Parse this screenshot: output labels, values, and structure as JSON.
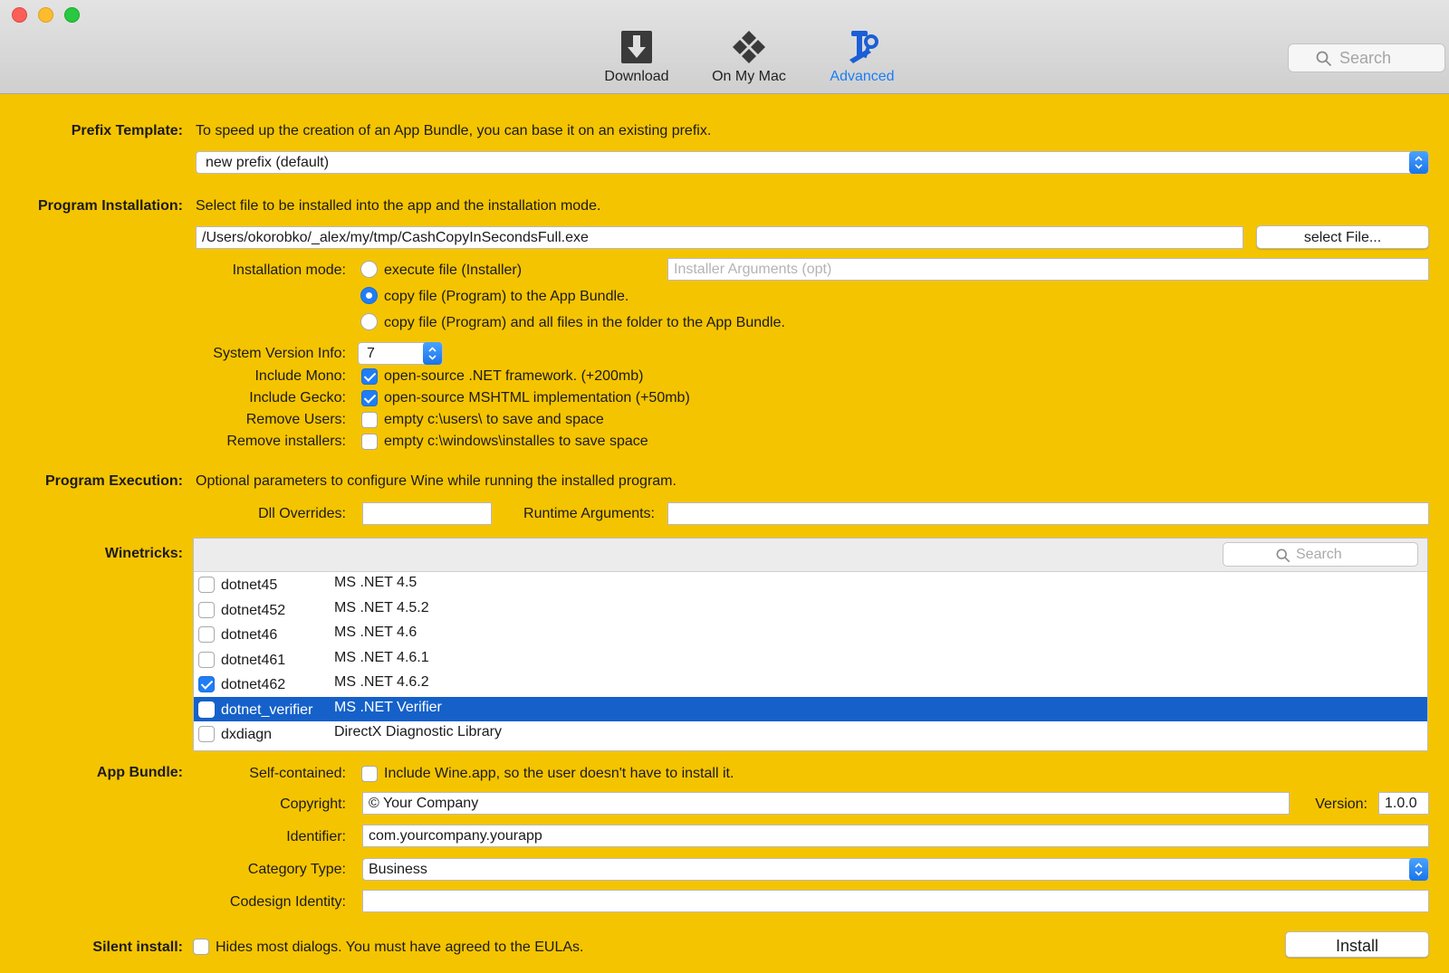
{
  "toolbar": {
    "download_label": "Download",
    "onmymac_label": "On My Mac",
    "advanced_label": "Advanced",
    "search_placeholder": "Search",
    "active_color": "#1b7ef5"
  },
  "prefix": {
    "label": "Prefix Template:",
    "description": "To speed up the creation of an App Bundle, you can base it on an existing prefix.",
    "selected": "new prefix (default)"
  },
  "install": {
    "label": "Program Installation:",
    "description": "Select file to be installed into the app and the installation mode.",
    "file_path": "/Users/okorobko/_alex/my/tmp/CashCopyInSecondsFull.exe",
    "select_button": "select File...",
    "mode_label": "Installation mode:",
    "modes": [
      {
        "label": "execute file (Installer)",
        "selected": false
      },
      {
        "label": "copy file (Program)  to the App Bundle.",
        "selected": true
      },
      {
        "label": "copy file (Program)  and all files in the folder to the App Bundle.",
        "selected": false
      }
    ],
    "installer_args_placeholder": "Installer Arguments (opt)",
    "sysver_label": "System Version Info:",
    "sysver_value": "7",
    "options": [
      {
        "label": "Include Mono:",
        "text": "open-source .NET framework. (+200mb)",
        "checked": true
      },
      {
        "label": "Include Gecko:",
        "text": "open-source MSHTML implementation (+50mb)",
        "checked": true
      },
      {
        "label": "Remove Users:",
        "text": "empty c:\\users\\ to save and space",
        "checked": false
      },
      {
        "label": "Remove installers:",
        "text": "empty c:\\windows\\installes to save space",
        "checked": false
      }
    ]
  },
  "execution": {
    "label": "Program Execution:",
    "description": "Optional parameters to configure Wine while running the installed program.",
    "dll_label": "Dll Overrides:",
    "dll_value": "",
    "runtime_label": "Runtime Arguments:",
    "runtime_value": ""
  },
  "winetricks": {
    "label": "Winetricks:",
    "search_placeholder": "Search",
    "items": [
      {
        "name": "dotnet45",
        "desc": "MS .NET 4.5",
        "checked": false,
        "selected": false
      },
      {
        "name": "dotnet452",
        "desc": "MS .NET 4.5.2",
        "checked": false,
        "selected": false
      },
      {
        "name": "dotnet46",
        "desc": "MS .NET 4.6",
        "checked": false,
        "selected": false
      },
      {
        "name": "dotnet461",
        "desc": "MS .NET 4.6.1",
        "checked": false,
        "selected": false
      },
      {
        "name": "dotnet462",
        "desc": "MS .NET 4.6.2",
        "checked": true,
        "selected": false
      },
      {
        "name": "dotnet_verifier",
        "desc": "MS .NET Verifier",
        "checked": false,
        "selected": true
      },
      {
        "name": "dxdiagn",
        "desc": "DirectX Diagnostic Library",
        "checked": false,
        "selected": false
      }
    ]
  },
  "bundle": {
    "label": "App Bundle:",
    "selfcontained_label": "Self-contained:",
    "selfcontained_text": "Include Wine.app, so the user doesn't have to install it.",
    "selfcontained_checked": false,
    "copyright_label": "Copyright:",
    "copyright_value": "© Your Company",
    "version_label": "Version:",
    "version_value": "1.0.0",
    "identifier_label": "Identifier:",
    "identifier_value": "com.yourcompany.yourapp",
    "category_label": "Category Type:",
    "category_value": "Business",
    "codesign_label": "Codesign Identity:",
    "codesign_value": ""
  },
  "silent": {
    "label": "Silent install:",
    "text": "Hides most dialogs. You must have agreed to the EULAs.",
    "checked": false
  },
  "install_button": "Install"
}
